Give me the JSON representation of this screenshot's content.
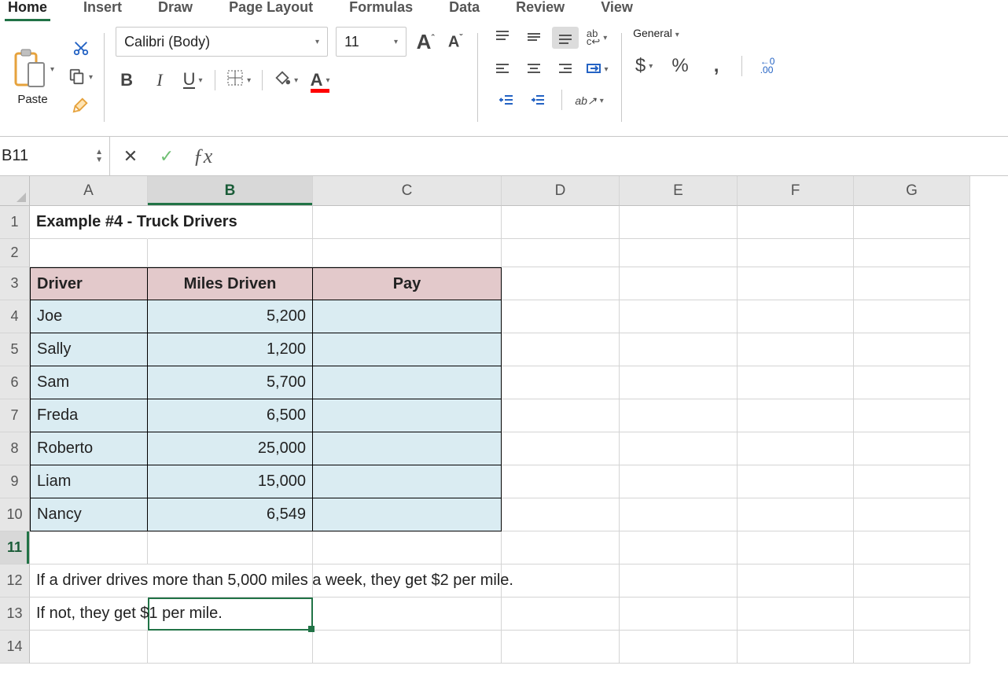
{
  "ribbon_tabs": {
    "home": "Home",
    "insert": "Insert",
    "draw": "Draw",
    "page_layout": "Page Layout",
    "formulas": "Formulas",
    "data": "Data",
    "review": "Review",
    "view": "View"
  },
  "clipboard": {
    "paste": "Paste"
  },
  "font": {
    "name": "Calibri (Body)",
    "size": "11",
    "bold": "B",
    "italic": "I",
    "underline": "U",
    "grow": "A",
    "shrink": "A"
  },
  "number": {
    "format": "General",
    "currency": "$",
    "percent": "%",
    "comma": ",",
    "inc_dec_left": "←0\n.00"
  },
  "namebox": "B11",
  "formula": "",
  "columns": [
    "A",
    "B",
    "C",
    "D",
    "E",
    "F",
    "G"
  ],
  "row_numbers": [
    "1",
    "2",
    "3",
    "4",
    "5",
    "6",
    "7",
    "8",
    "9",
    "10",
    "11",
    "12",
    "13",
    "14"
  ],
  "sheet": {
    "title": "Example #4 - Truck Drivers",
    "headers": {
      "driver": "Driver",
      "miles": "Miles Driven",
      "pay": "Pay"
    },
    "rows": [
      {
        "driver": "Joe",
        "miles": "5,200",
        "pay": ""
      },
      {
        "driver": "Sally",
        "miles": "1,200",
        "pay": ""
      },
      {
        "driver": "Sam",
        "miles": "5,700",
        "pay": ""
      },
      {
        "driver": "Freda",
        "miles": "6,500",
        "pay": ""
      },
      {
        "driver": "Roberto",
        "miles": "25,000",
        "pay": ""
      },
      {
        "driver": "Liam",
        "miles": "15,000",
        "pay": ""
      },
      {
        "driver": "Nancy",
        "miles": "6,549",
        "pay": ""
      }
    ],
    "note1": "If a driver drives more than 5,000 miles a week, they get $2 per mile.",
    "note2": "If not, they get $1 per mile."
  },
  "selected_cell": "B11"
}
